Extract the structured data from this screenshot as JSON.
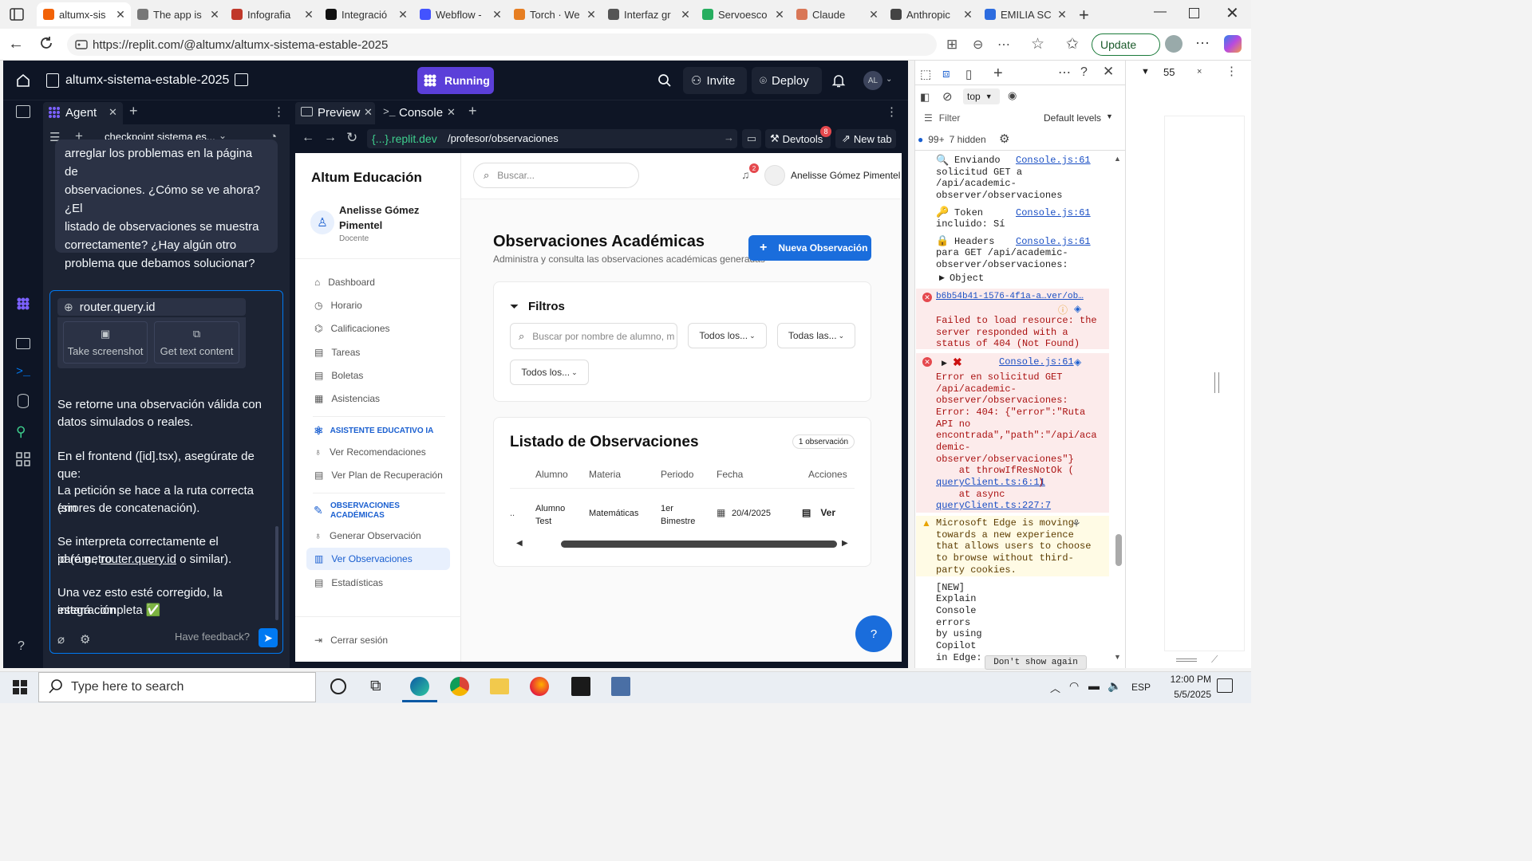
{
  "browser": {
    "tabs": [
      {
        "label": "altumx-sis",
        "color": "#f26207",
        "active": true
      },
      {
        "label": "The app is",
        "color": "#777777"
      },
      {
        "label": "Infografia",
        "color": "#c0392b"
      },
      {
        "label": "Integració",
        "color": "#111111"
      },
      {
        "label": "Webflow -",
        "color": "#4353ff"
      },
      {
        "label": "Torch · We",
        "color": "#e67e22"
      },
      {
        "label": "Interfaz gr",
        "color": "#555555"
      },
      {
        "label": "Servoesco",
        "color": "#27ae60"
      },
      {
        "label": "Claude",
        "color": "#d97757"
      },
      {
        "label": "Anthropic",
        "color": "#444444"
      },
      {
        "label": "EMILIA SC",
        "color": "#2d6cdf"
      }
    ],
    "url": "https://replit.com/@altumx/altumx-sistema-estable-2025",
    "update_label": "Update"
  },
  "replit": {
    "project_name": "altumx-sistema-estable-2025",
    "running_label": "Running",
    "invite_label": "Invite",
    "deploy_label": "Deploy",
    "avatar_initials": "AL",
    "agent_tab": "Agent",
    "checkpoint_label": "checkpoint sistema es...",
    "preview_tab": "Preview",
    "console_tab": "Console",
    "url_host": "{...}.replit.dev",
    "url_path": "/profesor/observaciones",
    "devtools_label": "Devtools",
    "devtools_badge": "8",
    "newtab_label": "New tab"
  },
  "agent": {
    "message_lines": [
      "arreglar los problemas en la página de",
      "observaciones. ¿Cómo se ve ahora? ¿El",
      "listado de observaciones se muestra",
      "correctamente? ¿Hay algún otro",
      "problema que debamos solucionar?"
    ],
    "tool_label": "router.query.id",
    "take_screenshot": "Take screenshot",
    "get_text": "Get text content",
    "lines": [
      "Se retorne una observación válida con",
      "datos simulados o reales.",
      "En el frontend ([id].tsx), asegúrate de que:",
      "La petición se hace a la ruta correcta (sin",
      "errores de concatenación).",
      "Se interpreta correctamente el parámetro",
      "id (e.g., ",
      "router.query.id",
      " o similar).",
      "Una vez esto esté corregido, la integración",
      "estará completa ✅"
    ],
    "feedback_placeholder": "Have feedback?"
  },
  "app": {
    "brand": "Altum Educación",
    "user_name_line1": "Anelisse Gómez",
    "user_name_line2": "Pimentel",
    "user_role": "Docente",
    "search_placeholder": "Buscar...",
    "notif_count": "2",
    "top_user": "Anelisse Gómez Pimentel",
    "nav": [
      "Dashboard",
      "Horario",
      "Calificaciones",
      "Tareas",
      "Boletas",
      "Asistencias"
    ],
    "section_ai": "ASISTENTE EDUCATIVO IA",
    "nav_ai": [
      "Ver Recomendaciones",
      "Ver Plan de Recuperación"
    ],
    "section_obs_line1": "OBSERVACIONES",
    "section_obs_line2": "ACADÉMICAS",
    "nav_obs": [
      "Generar Observación",
      "Ver Observaciones",
      "Estadísticas"
    ],
    "logout": "Cerrar sesión",
    "page_title": "Observaciones Académicas",
    "page_subtitle": "Administra y consulta las observaciones académicas generadas",
    "new_button": "Nueva Observación",
    "filters_title": "Filtros",
    "filter_search_placeholder": "Buscar por nombre de alumno, m",
    "filter1": "Todos los...",
    "filter2": "Todas las...",
    "filter3": "Todos los...",
    "list_title": "Listado de Observaciones",
    "list_count": "1 observación",
    "columns": [
      "Alumno",
      "Materia",
      "Periodo",
      "Fecha",
      "Acciones"
    ],
    "row": {
      "prefix": "..",
      "alumno_l1": "Alumno",
      "alumno_l2": "Test",
      "materia": "Matemáticas",
      "periodo_l1": "1er",
      "periodo_l2": "Bimestre",
      "fecha": "20/4/2025",
      "accion": "Ver"
    },
    "help_icon": "?"
  },
  "devtools": {
    "context": "top",
    "filter_label": "Filter",
    "levels_label": "Default levels",
    "count_label": "99+",
    "hidden_label": "7 hidden",
    "right_value": "55",
    "log1": [
      "Enviando",
      "solicitud GET a",
      "/api/academic-",
      "observer/observaciones"
    ],
    "log1_src": "Console.js:61",
    "log2": [
      "Token",
      "incluido: Sí"
    ],
    "log2_src": "Console.js:61",
    "log3": [
      "Headers",
      "para GET /api/academic-",
      "observer/observaciones:"
    ],
    "log3_src": "Console.js:61",
    "log3_obj": "Object",
    "err1_link": "b6b54b41-1576-4f1a-a…ver/ob…",
    "err1": [
      "Failed to load resource: the",
      "server responded with a",
      "status of 404 (Not Found)"
    ],
    "err2_src": "Console.js:61",
    "err2": [
      "Error en solicitud GET",
      "/api/academic-",
      "observer/observaciones:",
      "Error: 404: {\"error\":\"Ruta",
      "API no",
      "encontrada\",\"path\":\"/api/aca",
      "demic-",
      "observer/observaciones\"}",
      "    at throwIfResNotOk ("
    ],
    "err2_link1": "queryClient.ts:6:11",
    "err2_at": "    at async",
    "err2_link2": "queryClient.ts:227:7",
    "warn": [
      "Microsoft Edge is moving",
      "towards a new experience",
      "that allows users to choose",
      "to browse without third-",
      "party cookies."
    ],
    "explain": [
      "[NEW]",
      "Explain",
      "Console",
      "errors",
      "by using",
      "Copilot",
      "in Edge:"
    ],
    "dont_show": "Don't show again"
  },
  "taskbar": {
    "search_placeholder": "Type here to search",
    "time": "12:00 PM",
    "date": "5/5/2025",
    "lang": "ESP"
  }
}
